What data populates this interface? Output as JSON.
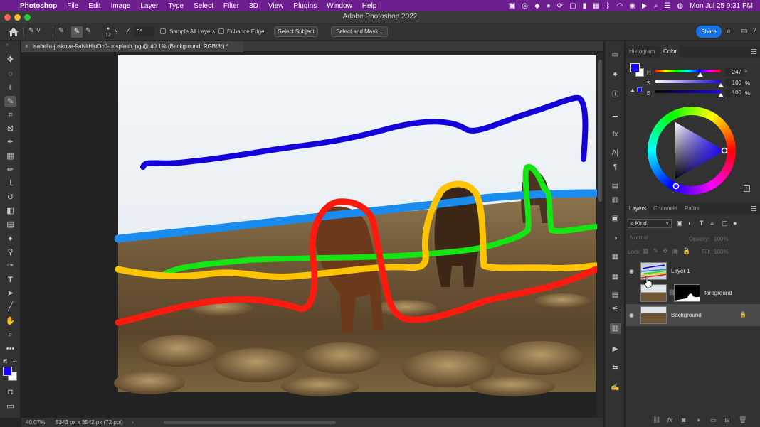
{
  "menubar": {
    "app_name": "Photoshop",
    "items": [
      "File",
      "Edit",
      "Image",
      "Layer",
      "Type",
      "Select",
      "Filter",
      "3D",
      "View",
      "Plugins",
      "Window",
      "Help"
    ],
    "clock": "Mon Jul 25  9:31 PM"
  },
  "window": {
    "title": "Adobe Photoshop 2022"
  },
  "options_bar": {
    "brush_size": "12",
    "angle": "0°",
    "sample_all_layers": "Sample All Layers",
    "enhance_edge": "Enhance Edge",
    "select_subject": "Select Subject",
    "select_and_mask": "Select and Mask...",
    "share": "Share"
  },
  "document": {
    "tab_title": "isabella-juskova-9aNltHjuOc0-unsplash.jpg @ 40.1% (Background, RGB/8*) *"
  },
  "status_bar": {
    "zoom": "40.07%",
    "doc_info": "5343 px x 3542 px (72 ppi)"
  },
  "color_panel": {
    "tabs": [
      "Histogram",
      "Color"
    ],
    "active_tab": "Color",
    "mode": "HSB",
    "h_label": "H",
    "s_label": "S",
    "b_label": "B",
    "h_value": "247",
    "s_value": "100",
    "b_value": "100",
    "h_unit": "°",
    "s_unit": "%",
    "b_unit": "%",
    "foreground_color": "#1a00ff",
    "background_color": "#ffffff"
  },
  "layers_panel": {
    "tabs": [
      "Layers",
      "Channels",
      "Paths"
    ],
    "active_tab": "Layers",
    "filter_kind": "Kind",
    "blend_mode": "Normal",
    "opacity_label": "Opacity:",
    "opacity_value": "100%",
    "lock_label": "Lock:",
    "fill_label": "Fill:",
    "fill_value": "100%",
    "layers": [
      {
        "name": "Layer 1",
        "visible": true,
        "selected": false
      },
      {
        "name": "foreground",
        "visible": false,
        "selected": false,
        "has_mask": true
      },
      {
        "name": "Background",
        "visible": true,
        "selected": true,
        "locked": true
      }
    ]
  },
  "colors": {
    "menubar_bg": "#6e1f8f",
    "accent": "#1473e6",
    "stroke_blue": "#1400d8",
    "stroke_lightblue": "#1a8cf0",
    "stroke_green": "#14e614",
    "stroke_yellow": "#ffc400",
    "stroke_red": "#ff1a10"
  },
  "icons": {
    "tools": [
      "move-icon",
      "marquee-icon",
      "lasso-icon",
      "quick-selection-icon",
      "crop-icon",
      "frame-icon",
      "eyedropper-icon",
      "patch-icon",
      "brush-icon",
      "stamp-icon",
      "history-brush-icon",
      "eraser-icon",
      "gradient-icon",
      "blur-icon",
      "dodge-icon",
      "pen-icon",
      "type-icon",
      "path-selection-icon",
      "line-icon",
      "hand-icon",
      "zoom-icon",
      "more-icon"
    ]
  }
}
